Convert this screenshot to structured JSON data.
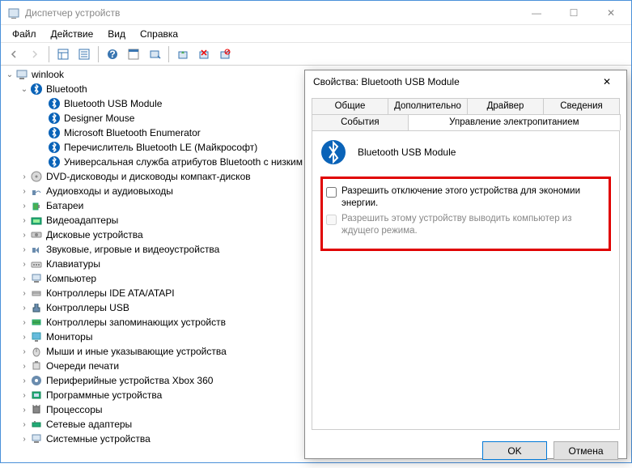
{
  "window": {
    "title": "Диспетчер устройств",
    "controls": {
      "minimize": "—",
      "maximize": "☐",
      "close": "✕"
    }
  },
  "menubar": [
    "Файл",
    "Действие",
    "Вид",
    "Справка"
  ],
  "tree": {
    "root": {
      "label": "winlook"
    },
    "bluetooth": {
      "label": "Bluetooth"
    },
    "bt_children": [
      "Bluetooth USB Module",
      "Designer Mouse",
      "Microsoft Bluetooth Enumerator",
      "Перечислитель Bluetooth LE (Майкрософт)",
      "Универсальная служба атрибутов Bluetooth с низким уровнем потребления"
    ],
    "categories": [
      "DVD-дисководы и дисководы компакт-дисков",
      "Аудиовходы и аудиовыходы",
      "Батареи",
      "Видеоадаптеры",
      "Дисковые устройства",
      "Звуковые, игровые и видеоустройства",
      "Клавиатуры",
      "Компьютер",
      "Контроллеры IDE ATA/ATAPI",
      "Контроллеры USB",
      "Контроллеры запоминающих устройств",
      "Мониторы",
      "Мыши и иные указывающие устройства",
      "Очереди печати",
      "Периферийные устройства Xbox 360",
      "Программные устройства",
      "Процессоры",
      "Сетевые адаптеры",
      "Системные устройства"
    ]
  },
  "dialog": {
    "title": "Свойства: Bluetooth USB Module",
    "close": "✕",
    "tabs_back": [
      "Общие",
      "Дополнительно",
      "Драйвер",
      "Сведения"
    ],
    "tabs_front": [
      "События",
      "Управление электропитанием"
    ],
    "device_name": "Bluetooth USB Module",
    "checkbox1": "Разрешить отключение этого устройства для экономии энергии.",
    "checkbox2": "Разрешить этому устройству выводить компьютер из ждущего режима.",
    "ok": "OK",
    "cancel": "Отмена"
  }
}
